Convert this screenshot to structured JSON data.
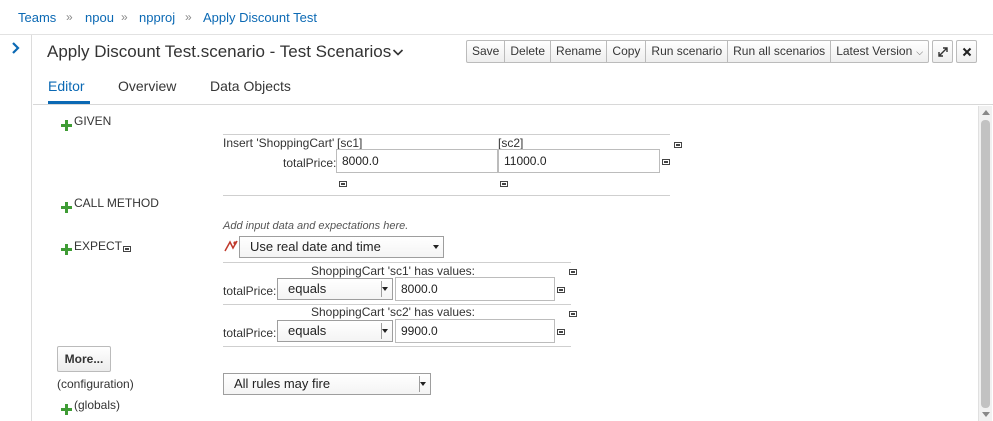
{
  "breadcrumb": {
    "items": [
      "Teams",
      "npou",
      "npproj",
      "Apply Discount Test"
    ],
    "separator": "»"
  },
  "header": {
    "title": "Apply Discount Test.scenario - Test Scenarios",
    "toolbar": {
      "save": "Save",
      "delete": "Delete",
      "rename": "Rename",
      "copy": "Copy",
      "run_scenario": "Run scenario",
      "run_all": "Run all scenarios",
      "version": "Latest Version"
    }
  },
  "tabs": [
    "Editor",
    "Overview",
    "Data Objects"
  ],
  "given": {
    "label": "GIVEN",
    "insert_label": "Insert 'ShoppingCart'",
    "scenarios": [
      "[sc1]",
      "[sc2]"
    ],
    "field_label": "totalPrice:",
    "values": [
      "8000.0",
      "11000.0"
    ]
  },
  "call_method": {
    "label": "CALL METHOD",
    "hint": "Add input data and expectations here."
  },
  "expect": {
    "label": "EXPECT",
    "date_option": "Use real date and time",
    "rows": [
      {
        "header": "ShoppingCart 'sc1' has values:",
        "field": "totalPrice:",
        "operator": "equals",
        "value": "8000.0"
      },
      {
        "header": "ShoppingCart 'sc2' has values:",
        "field": "totalPrice:",
        "operator": "equals",
        "value": "9900.0"
      }
    ]
  },
  "config": {
    "more_button": "More...",
    "configuration_label": "(configuration)",
    "rules_option": "All rules may fire",
    "globals_label": "(globals)"
  },
  "colors": {
    "link": "#0b69b4",
    "plus_icon": "#3f9c35"
  }
}
